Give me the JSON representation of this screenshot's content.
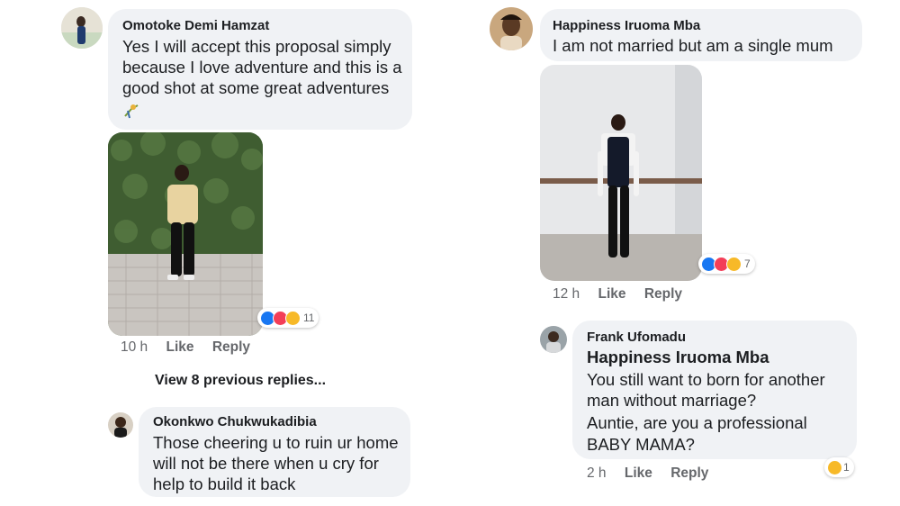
{
  "comments": {
    "c1": {
      "author": "Omotoke Demi Hamzat",
      "lines": [
        "Yes I will accept this proposal simply",
        "because I love adventure and this is a",
        "good shot at some great adventures"
      ],
      "reaction_count": "11",
      "time": "10 h",
      "like_label": "Like",
      "reply_label": "Reply"
    },
    "view_more": "View 8 previous replies...",
    "c2": {
      "author": "Okonkwo Chukwukadibia",
      "lines": [
        "Those cheering u to ruin ur home",
        "will not be there when u cry for",
        "help to build it back"
      ]
    },
    "c3": {
      "author": "Happiness Iruoma Mba",
      "lines": [
        "I am not married but am a single mum"
      ],
      "reaction_count": "7",
      "time": "12 h",
      "like_label": "Like",
      "reply_label": "Reply"
    },
    "c4": {
      "author": "Frank Ufomadu",
      "mention": "Happiness Iruoma Mba",
      "lines": [
        "You still want to born for another",
        "man without marriage?",
        "Auntie, are you a professional",
        "BABY MAMA?"
      ],
      "reaction_count": "1",
      "time": "2 h",
      "like_label": "Like",
      "reply_label": "Reply"
    }
  },
  "colors": {
    "bubble": "#f0f2f5",
    "secondary_text": "#65676b",
    "like_blue": "#1877f2",
    "love_red": "#f33e58",
    "haha_yellow": "#f7b928"
  },
  "icons": [
    "like-reaction-icon",
    "love-reaction-icon",
    "haha-reaction-icon",
    "sad-reaction-icon"
  ]
}
